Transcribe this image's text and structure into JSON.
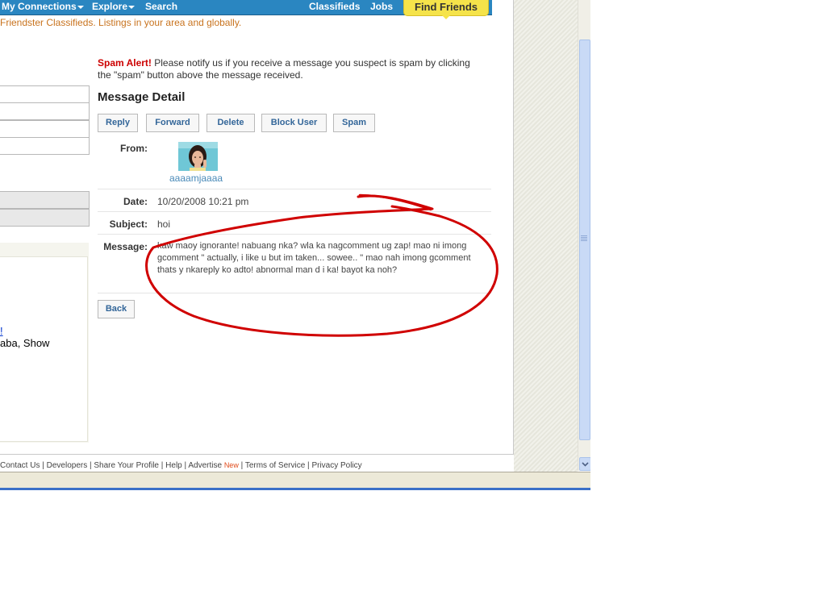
{
  "nav": {
    "my_connections": "My Connections",
    "explore": "Explore",
    "search": "Search",
    "classifieds": "Classifieds",
    "jobs": "Jobs",
    "find_friends": "Find Friends"
  },
  "classifieds_tagline": "Friendster Classifieds. Listings in your area and globally.",
  "left": {
    "link_fragment": "!",
    "text_fragment": "aba, Show"
  },
  "spam_alert": {
    "label": "Spam Alert!",
    "text": " Please notify us if you receive a message you suspect is spam by clicking the \"spam\" button above the message received."
  },
  "message_detail": {
    "heading": "Message Detail",
    "buttons": {
      "reply": "Reply",
      "forward": "Forward",
      "delete": "Delete",
      "block_user": "Block User",
      "spam": "Spam"
    },
    "from_label": "From:",
    "from_name": "aaaamjaaaa",
    "date_label": "Date:",
    "date_value": "10/20/2008 10:21 pm",
    "subject_label": "Subject:",
    "subject_value": "hoi",
    "message_label": "Message:",
    "message_value": "kaw maoy ignorante! nabuang nka? wla ka nagcomment ug zap! mao ni imong gcomment \" actually, i like u but im taken... sowee.. \" mao nah imong gcomment thats y nkareply ko adto! abnormal man d i ka! bayot ka noh?",
    "back": "Back"
  },
  "footer": {
    "contact": "Contact Us",
    "developers": "Developers",
    "share": "Share Your Profile",
    "help": "Help",
    "advertise": "Advertise",
    "new_badge": "New",
    "terms": "Terms of Service",
    "privacy": "Privacy Policy"
  },
  "colors": {
    "nav_bg": "#2a86c1",
    "find_friends_bg": "#f5e34a",
    "spam_alert_red": "#cc0000",
    "annotation_red": "#d00000",
    "link_blue": "#336699"
  }
}
